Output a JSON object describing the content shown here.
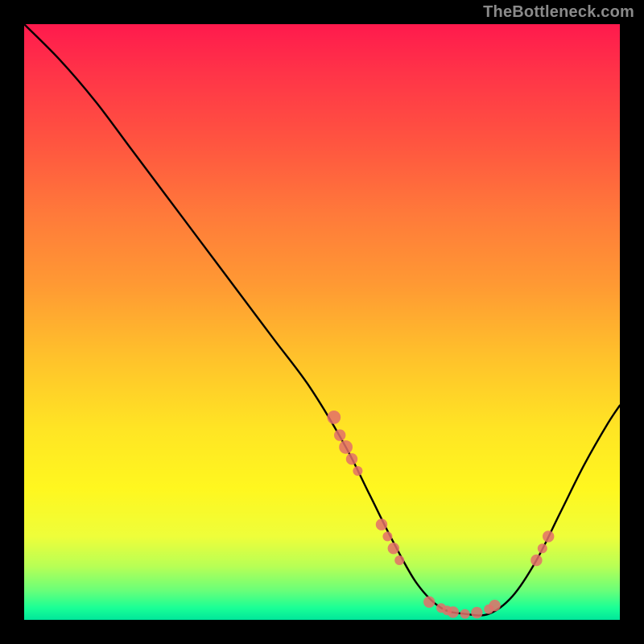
{
  "watermark": "TheBottleneck.com",
  "chart_data": {
    "type": "line",
    "title": "",
    "xlabel": "",
    "ylabel": "",
    "xlim": [
      0,
      100
    ],
    "ylim": [
      0,
      100
    ],
    "grid": false,
    "legend": false,
    "series": [
      {
        "name": "bottleneck-curve",
        "x": [
          0,
          6,
          12,
          18,
          24,
          30,
          36,
          42,
          48,
          54,
          58,
          62,
          66,
          70,
          74,
          78,
          82,
          86,
          90,
          94,
          98,
          100
        ],
        "y": [
          100,
          94,
          87,
          79,
          71,
          63,
          55,
          47,
          39,
          29,
          21,
          13,
          6,
          2,
          1,
          1,
          4,
          10,
          18,
          26,
          33,
          36
        ]
      }
    ],
    "markers": [
      {
        "x": 52,
        "y": 34,
        "r": 1.4
      },
      {
        "x": 53,
        "y": 31,
        "r": 1.2
      },
      {
        "x": 54,
        "y": 29,
        "r": 1.4
      },
      {
        "x": 55,
        "y": 27,
        "r": 1.2
      },
      {
        "x": 56,
        "y": 25,
        "r": 1.0
      },
      {
        "x": 60,
        "y": 16,
        "r": 1.2
      },
      {
        "x": 61,
        "y": 14,
        "r": 1.0
      },
      {
        "x": 62,
        "y": 12,
        "r": 1.2
      },
      {
        "x": 63,
        "y": 10,
        "r": 1.0
      },
      {
        "x": 68,
        "y": 3,
        "r": 1.2
      },
      {
        "x": 70,
        "y": 2,
        "r": 1.0
      },
      {
        "x": 71,
        "y": 1.6,
        "r": 1.0
      },
      {
        "x": 72,
        "y": 1.3,
        "r": 1.2
      },
      {
        "x": 74,
        "y": 1.0,
        "r": 1.0
      },
      {
        "x": 76,
        "y": 1.2,
        "r": 1.2
      },
      {
        "x": 78,
        "y": 1.8,
        "r": 1.0
      },
      {
        "x": 79,
        "y": 2.4,
        "r": 1.2
      },
      {
        "x": 86,
        "y": 10,
        "r": 1.2
      },
      {
        "x": 87,
        "y": 12,
        "r": 1.0
      },
      {
        "x": 88,
        "y": 14,
        "r": 1.2
      }
    ],
    "colors": {
      "curve": "#000000",
      "marker": "#e36f6a",
      "gradient_top": "#ff1a4d",
      "gradient_bottom": "#00e69a"
    }
  }
}
